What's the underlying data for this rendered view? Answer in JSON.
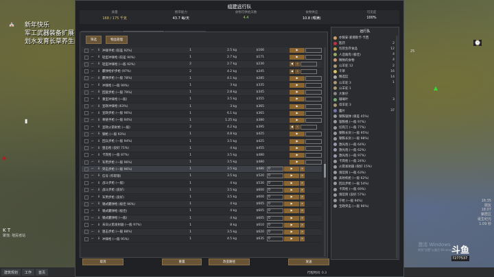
{
  "stream": {
    "line1": "新年快乐",
    "line2": "军工武器装备扩展",
    "line3": "划水发育长草养生的日常"
  },
  "map": {
    "label_near_window": "25",
    "right_hud": [
      "16:35",
      "朋友",
      "18:07",
      "聚居区",
      "诞生纪元",
      "1.09 秒"
    ],
    "kt_title": "K T",
    "kt_sub": "聚落: 殖民者站"
  },
  "bottom_tabs": [
    "建筑规划",
    "工作",
    "首页"
  ],
  "watermark": {
    "title": "激活 Windows",
    "sub": "转到\"设置\"以激活 Windows"
  },
  "douyu": {
    "logo": "斗鱼",
    "id": "7277537"
  },
  "window": {
    "title": "组建远行队",
    "stats": [
      {
        "label": "质量",
        "value": "168 / 175 千克",
        "tone": "gold"
      },
      {
        "label": "携带能力",
        "value": "43.7 每/天",
        "tone": ""
      },
      {
        "label": "食物可供给天数",
        "value": "4.4",
        "tone": "green"
      },
      {
        "label": "食物供应",
        "value": "10.8 (喂满)",
        "tone": ""
      },
      {
        "label": "可见度",
        "value": "100%",
        "tone": ""
      }
    ],
    "tabs": [
      "人员动物",
      "物品",
      "旅行物资"
    ],
    "filters": [
      "筛选",
      "物品管理"
    ],
    "rows": [
      {
        "name": "冲锋手枪 (较差 92%)",
        "have": "1",
        "mass": "2.5 kg",
        "price": "$166",
        "count": "",
        "arrows": 2
      },
      {
        "name": "轻型冲锋枪 (较差 90%)",
        "have": "1",
        "mass": "2.7 kg",
        "price": "$171",
        "count": "",
        "arrows": 2
      },
      {
        "name": "轻型冲锋枪 (一般 92%)",
        "have": "2",
        "mass": "2.7 kg",
        "price": "$230",
        "count": "",
        "arrows": 3
      },
      {
        "name": "霰弹枪护步枪 (97%)",
        "have": "2",
        "mass": "4.2 kg",
        "price": "$245",
        "count": "",
        "arrows": 3
      },
      {
        "name": "霰弹步枪 (一般 78%)",
        "have": "1",
        "mass": "4.1 kg",
        "price": "$285",
        "count": "",
        "arrows": 2
      },
      {
        "name": "冲锋枪 (一般 99%)",
        "have": "1",
        "mass": "3 kg",
        "price": "$335",
        "count": "",
        "arrows": 2
      },
      {
        "name": "回旋步枪 (一般 79%)",
        "have": "1",
        "mass": "2.8 kg",
        "price": "$345",
        "count": "",
        "arrows": 2
      },
      {
        "name": "重型冲锋枪 (一般)",
        "have": "1",
        "mass": "3.5 kg",
        "price": "$355",
        "count": "",
        "arrows": 2
      },
      {
        "name": "宣政冲锋枪 (63%)",
        "have": "1",
        "mass": "3 kg",
        "price": "$365",
        "count": "",
        "arrows": 2
      },
      {
        "name": "宣政步枪 (一般 96%)",
        "have": "1",
        "mass": "6.1 kg",
        "price": "$365",
        "count": "",
        "arrows": 2
      },
      {
        "name": "骨链手枪 (一般 94%)",
        "have": "1",
        "mass": "1.25 kg",
        "price": "$380",
        "count": "",
        "arrows": 2
      },
      {
        "name": "宣政火箭射枪 (一般)",
        "have": "2",
        "mass": "4.2 kg",
        "price": "$395",
        "count": "",
        "arrows": 3
      },
      {
        "name": "钢枪 (一般 93%)",
        "have": "1",
        "mass": "4.8 kg",
        "price": "$425",
        "count": "",
        "arrows": 2
      },
      {
        "name": "回兵步枪 (一般 94%)",
        "have": "1",
        "mass": "3.5 kg",
        "price": "$425",
        "count": "",
        "arrows": 2
      },
      {
        "name": "狙击枪 (良好 71%)",
        "have": "1",
        "mass": "4 kg",
        "price": "$455",
        "count": "",
        "arrows": 2
      },
      {
        "name": "卡宾枪 (一般 87%)",
        "have": "1",
        "mass": "3.5 kg",
        "price": "$480",
        "count": "",
        "arrows": 2
      },
      {
        "name": "军用步枪 (一般 96%)",
        "have": "1",
        "mass": "3.5 kg",
        "price": "$480",
        "count": "",
        "arrows": 2
      },
      {
        "name": "突击步枪 (一般 96%)",
        "have": "1",
        "mass": "3.5 kg",
        "price": "$480",
        "count": "0",
        "arrows": 9
      },
      {
        "name": "信号 (作帮镜)",
        "have": "1",
        "mass": "3.5 kg",
        "price": "$520",
        "count": "0",
        "arrows": 9
      },
      {
        "name": "战斗步枪 (一般)",
        "have": "1",
        "mass": "4 kg",
        "price": "$530",
        "count": "0",
        "arrows": 9
      },
      {
        "name": "战斗步枪 (良好)",
        "have": "1",
        "mass": "3.5 kg",
        "price": "$600",
        "count": "0",
        "arrows": 9
      },
      {
        "name": "军用步枪 (良好)",
        "have": "1",
        "mass": "3.5 kg",
        "price": "$600",
        "count": "0",
        "arrows": 9
      },
      {
        "name": "锡式霰弹枪 (极佳 96%)",
        "have": "1",
        "mass": "4 kg",
        "price": "$605",
        "count": "0",
        "arrows": 9
      },
      {
        "name": "锡式霰弹枪 (极佳)",
        "have": "1",
        "mass": "4 kg",
        "price": "$605",
        "count": "0",
        "arrows": 9
      },
      {
        "name": "锡式霰弹枪 (一般)",
        "have": "1",
        "mass": "4 kg",
        "price": "$605",
        "count": "0",
        "arrows": 9
      },
      {
        "name": "未日火箭发射器 (一般 97%)",
        "have": "1",
        "mass": "8 kg",
        "price": "$610",
        "count": "0",
        "arrows": 9
      },
      {
        "name": "狙击步枪 (一般 88%)",
        "have": "1",
        "mass": "3.5 kg",
        "price": "$620",
        "count": "0",
        "arrows": 9
      },
      {
        "name": "冲锋枪 (一般 95%)",
        "have": "1",
        "mass": "4.5 kg",
        "price": "$635",
        "count": "0",
        "arrows": 9
      }
    ],
    "side_title": "远行队",
    "side_rows": [
      {
        "label": "亦银安·爱德斯卡·卡西",
        "n": "",
        "color": "#c9a06a"
      },
      {
        "label": "医药",
        "n": "2",
        "color": "#b34"
      },
      {
        "label": "包装生存食品",
        "n": "12",
        "color": "#b8a050"
      },
      {
        "label": "人造腐肉 (极佳)",
        "n": "4",
        "color": "#9a6"
      },
      {
        "label": "精致的食物",
        "n": "4",
        "color": "#c97"
      },
      {
        "label": "公羊驼 12",
        "n": "2",
        "color": "#a97"
      },
      {
        "label": "干草",
        "n": "16",
        "color": "#d5c26a"
      },
      {
        "label": "精选缸",
        "n": "14",
        "color": "#aaa"
      },
      {
        "label": "公羊驼 3",
        "n": "1",
        "color": "#a97"
      },
      {
        "label": "公羊驼 1",
        "n": "",
        "color": "#a97"
      },
      {
        "label": "大象仔",
        "n": "",
        "color": "#888"
      },
      {
        "label": "珊瑚叶",
        "n": "3",
        "color": "#7a7"
      },
      {
        "label": "母羊驼 3",
        "n": "",
        "color": "#a97"
      },
      {
        "label": "露片",
        "n": "37",
        "color": "#77a"
      },
      {
        "label": "钢铁锯弹 (很差 45%)",
        "n": "",
        "color": "#999"
      },
      {
        "label": "锯铁棍 (一般 97%)",
        "n": "",
        "color": "#999"
      },
      {
        "label": "切肉刀 (一般 77%)",
        "n": "",
        "color": "#999"
      },
      {
        "label": "钢铁长剑 (一般 95%)",
        "n": "",
        "color": "#999"
      },
      {
        "label": "钢铁长剑 (一般 98%)",
        "n": "",
        "color": "#999"
      },
      {
        "label": "激光炮 (一般 64%)",
        "n": "",
        "color": "#99a"
      },
      {
        "label": "激光炮 (一般 62%)",
        "n": "",
        "color": "#99a"
      },
      {
        "label": "激光炮 (一般 97%)",
        "n": "",
        "color": "#99a"
      },
      {
        "label": "卡宾枪 (一般 24%)",
        "n": "",
        "color": "#999"
      },
      {
        "label": "火箭发射器 (很好 15%)",
        "n": "",
        "color": "#999"
      },
      {
        "label": "煤炭筒 (一般 63%)",
        "n": "",
        "color": "#999"
      },
      {
        "label": "高射机枪 (一般 62%)",
        "n": "",
        "color": "#999"
      },
      {
        "label": "回兵步枪 (一般 54%)",
        "n": "",
        "color": "#999"
      },
      {
        "label": "卡宾枪 (一般 69%)",
        "n": "",
        "color": "#999"
      },
      {
        "label": "煤炭筒 (良好 57%)",
        "n": "",
        "color": "#999"
      },
      {
        "label": "宁枪 (一般 94%)",
        "n": "",
        "color": "#999"
      },
      {
        "label": "宝政突击 (一般 96%)",
        "n": "",
        "color": "#999"
      }
    ],
    "buttons": {
      "cancel": "取消",
      "reset": "重置",
      "change_dest": "改变路径",
      "send": "发送"
    },
    "weight_label": "行程时间: 0.3"
  }
}
